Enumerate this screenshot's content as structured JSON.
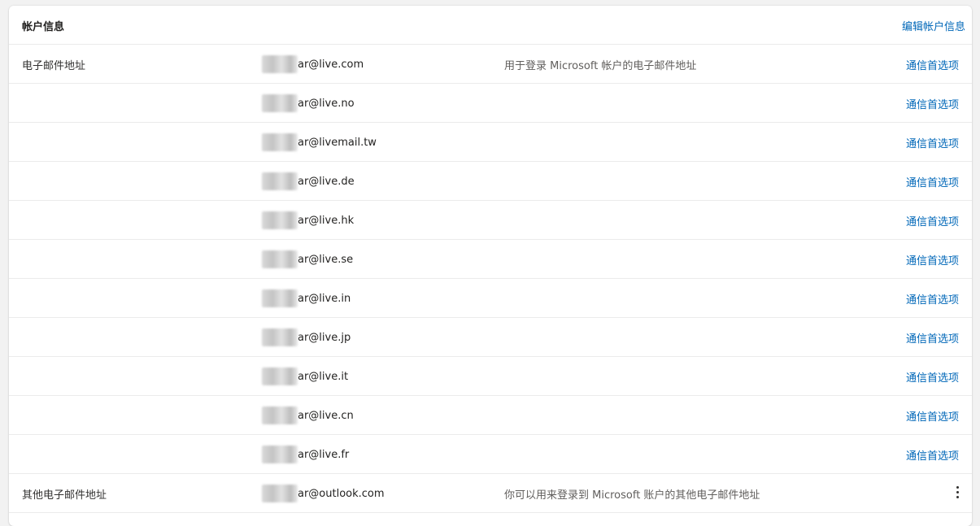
{
  "header": {
    "title": "帐户信息",
    "edit_link": "编辑帐户信息"
  },
  "rows": [
    {
      "label": "电子邮件地址",
      "email": "ar@live.com",
      "description": "用于登录 Microsoft 帐户的电子邮件地址",
      "action": "通信首选项"
    },
    {
      "label": "",
      "email": "ar@live.no",
      "description": "",
      "action": "通信首选项"
    },
    {
      "label": "",
      "email": "ar@livemail.tw",
      "description": "",
      "action": "通信首选项"
    },
    {
      "label": "",
      "email": "ar@live.de",
      "description": "",
      "action": "通信首选项"
    },
    {
      "label": "",
      "email": "ar@live.hk",
      "description": "",
      "action": "通信首选项"
    },
    {
      "label": "",
      "email": "ar@live.se",
      "description": "",
      "action": "通信首选项"
    },
    {
      "label": "",
      "email": "ar@live.in",
      "description": "",
      "action": "通信首选项"
    },
    {
      "label": "",
      "email": "ar@live.jp",
      "description": "",
      "action": "通信首选项"
    },
    {
      "label": "",
      "email": "ar@live.it",
      "description": "",
      "action": "通信首选项"
    },
    {
      "label": "",
      "email": "ar@live.cn",
      "description": "",
      "action": "通信首选项"
    },
    {
      "label": "",
      "email": "ar@live.fr",
      "description": "",
      "action": "通信首选项"
    }
  ],
  "other_row": {
    "label": "其他电子邮件地址",
    "email": "ar@outlook.com",
    "description": "你可以用来登录到 Microsoft 账户的其他电子邮件地址",
    "menu_icon": "more-vertical-icon"
  },
  "colors": {
    "link": "#0067b8",
    "divider": "#ebebeb"
  }
}
